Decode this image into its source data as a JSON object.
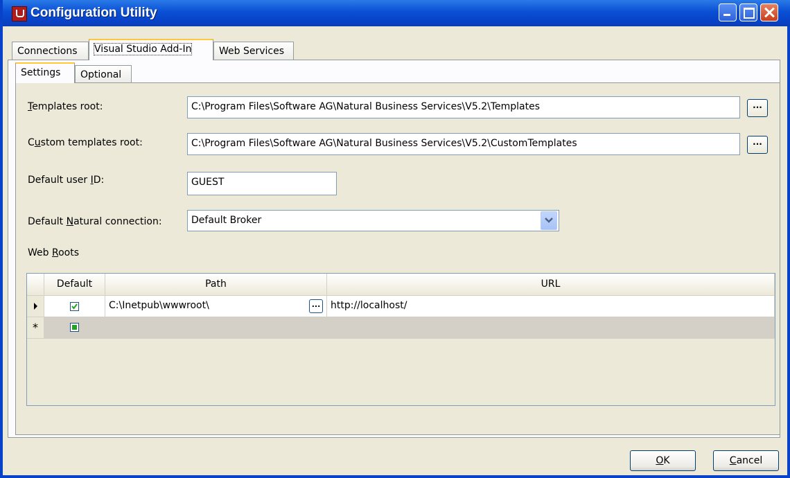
{
  "window": {
    "title": "Configuration Utility"
  },
  "main_tabs": [
    {
      "label": "Connections"
    },
    {
      "label": "Visual Studio Add-In"
    },
    {
      "label": "Web Services"
    }
  ],
  "sub_tabs": [
    {
      "label": "Settings"
    },
    {
      "label": "Optional"
    }
  ],
  "form": {
    "templates_root": {
      "label_pre": "",
      "label_acc": "T",
      "label_post": "emplates root:",
      "value": "C:\\Program Files\\Software AG\\Natural Business Services\\V5.2\\Templates"
    },
    "custom_templates_root": {
      "label_pre": "C",
      "label_acc": "u",
      "label_post": "stom templates root:",
      "value": "C:\\Program Files\\Software AG\\Natural Business Services\\V5.2\\CustomTemplates"
    },
    "default_user_id": {
      "label_pre": "Default user ",
      "label_acc": "I",
      "label_post": "D:",
      "value": "GUEST"
    },
    "default_natural_connection": {
      "label_pre": "Default ",
      "label_acc": "N",
      "label_post": "atural connection:",
      "value": "Default Broker"
    },
    "browse_label": "...",
    "web_roots_label": {
      "pre": "Web ",
      "acc": "R",
      "post": "oots"
    }
  },
  "grid": {
    "columns": [
      "Default",
      "Path",
      "URL"
    ],
    "rows": [
      {
        "default": true,
        "path": "C:\\Inetpub\\wwwroot\\",
        "url": "http://localhost/"
      }
    ],
    "new_row_marker": "*"
  },
  "buttons": {
    "ok": {
      "acc": "O",
      "post": "K"
    },
    "cancel": {
      "acc": "C",
      "post": "ancel"
    }
  },
  "colors": {
    "title_bar": "#0842c8",
    "active_tab_accent": "#ffc73c",
    "check_green": "#22a322"
  }
}
